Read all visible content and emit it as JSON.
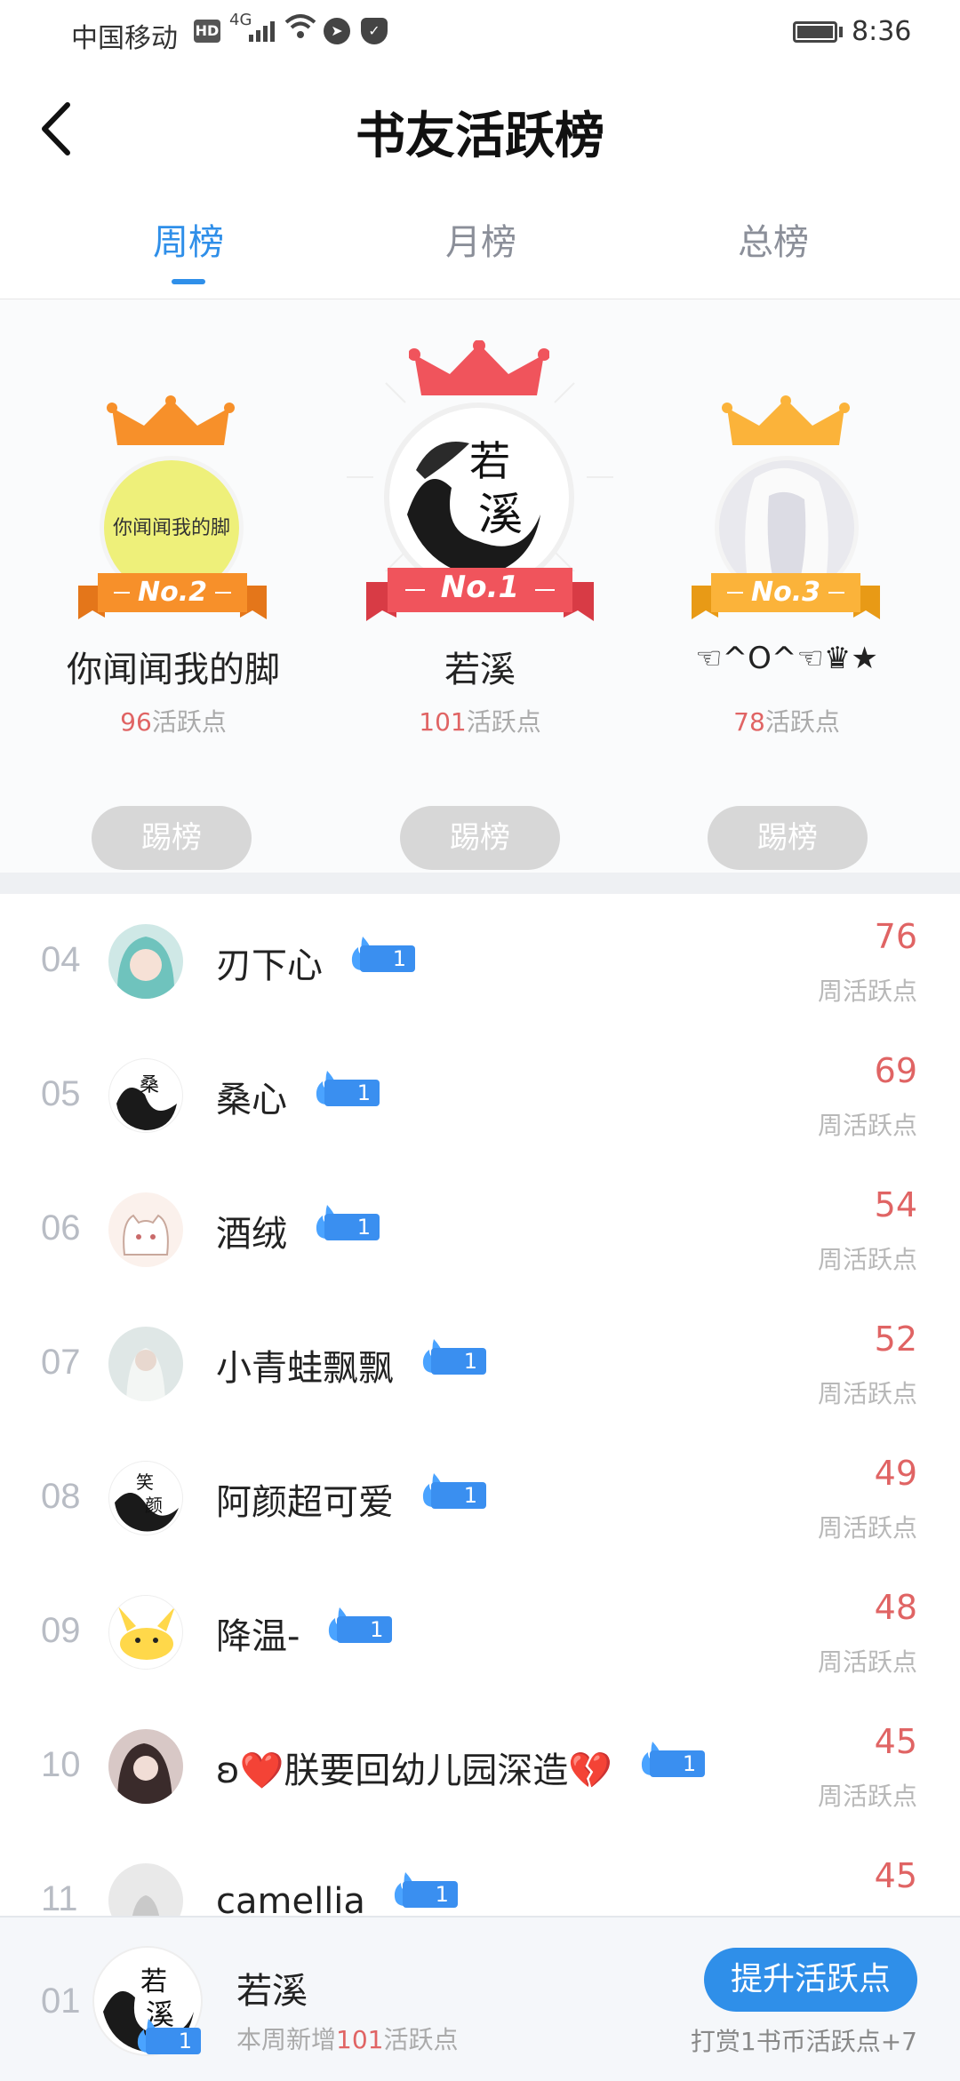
{
  "status_bar": {
    "carrier": "中国移动",
    "hd": "HD",
    "network": "4G",
    "time": "8:36"
  },
  "header": {
    "title": "书友活跃榜"
  },
  "tabs": [
    {
      "label": "周榜",
      "active": true
    },
    {
      "label": "月榜",
      "active": false
    },
    {
      "label": "总榜",
      "active": false
    }
  ],
  "podium": {
    "first": {
      "rank_label": "No.1",
      "name": "若溪",
      "points": "101",
      "points_suffix": "活跃点",
      "button": "踢榜",
      "avatar_text_top": "若",
      "avatar_text_bottom": "溪"
    },
    "second": {
      "rank_label": "No.2",
      "name": "你闻闻我的脚",
      "points": "96",
      "points_suffix": "活跃点",
      "button": "踢榜",
      "avatar_text": "你闻闻我的脚"
    },
    "third": {
      "rank_label": "No.3",
      "name": "☜^O^☜♛★",
      "points": "78",
      "points_suffix": "活跃点",
      "button": "踢榜"
    }
  },
  "ranking": {
    "score_label": "周活跃点",
    "rows": [
      {
        "rank": "04",
        "name": "刃下心",
        "badge": "1",
        "score": "76"
      },
      {
        "rank": "05",
        "name": "桑心",
        "badge": "1",
        "score": "69"
      },
      {
        "rank": "06",
        "name": "酒绒",
        "badge": "1",
        "score": "54"
      },
      {
        "rank": "07",
        "name": "小青蛙飘飘",
        "badge": "1",
        "score": "52"
      },
      {
        "rank": "08",
        "name": "阿颜超可爱",
        "badge": "1",
        "score": "49"
      },
      {
        "rank": "09",
        "name": "降温-",
        "badge": "1",
        "score": "48"
      },
      {
        "rank": "10",
        "name": "ʚ❤️朕要回幼儿园深造💔",
        "badge": "1",
        "score": "45"
      },
      {
        "rank": "11",
        "name": "camellia",
        "badge": "1",
        "score": "45"
      }
    ]
  },
  "my_rank": {
    "rank": "01",
    "name": "若溪",
    "badge": "1",
    "sub_prefix": "本周新增",
    "sub_number": "101",
    "sub_suffix": "活跃点",
    "button": "提升活跃点",
    "reward_note": "打赏1书币活跃点+7"
  },
  "colors": {
    "accent_blue": "#2f8fe9",
    "score_red": "#e06464",
    "crown_gold": "#fbb33a",
    "crown_red": "#f0545c",
    "crown_orange": "#f7902a"
  }
}
